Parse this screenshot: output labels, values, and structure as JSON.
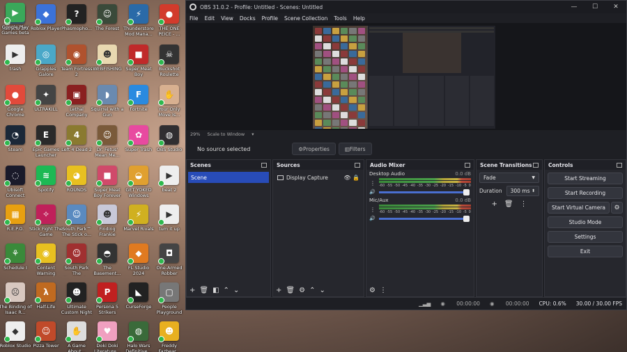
{
  "desktop": {
    "icons": [
      {
        "label": "Recycle Bin",
        "glyph": "🗑",
        "color": "#4a6b8c"
      },
      {
        "label": "Roblox Player",
        "glyph": "◆",
        "color": "#3b72d9"
      },
      {
        "label": "Phasmopho...",
        "glyph": "?",
        "color": "#222222"
      },
      {
        "label": "The Forest",
        "glyph": "☺",
        "color": "#3a4a3a"
      },
      {
        "label": "Thunderstore Mod Mana...",
        "glyph": "⚡",
        "color": "#2a6aa8"
      },
      {
        "label": "THE ONE PEICE - ...",
        "glyph": "●",
        "color": "#d23b2c"
      },
      {
        "label": "trash",
        "glyph": "▶",
        "color": "#eeeeee"
      },
      {
        "label": "Grapples Galore",
        "glyph": "◎",
        "color": "#4aa8c8"
      },
      {
        "label": "Team Fortress 2",
        "glyph": "◉",
        "color": "#b0522e"
      },
      {
        "label": "WEBFISHING",
        "glyph": "☻",
        "color": "#e8d8b0"
      },
      {
        "label": "Super Meat Boy",
        "glyph": "■",
        "color": "#c02a2a"
      },
      {
        "label": "Buckshot Roulette",
        "glyph": "☠",
        "color": "#333333"
      },
      {
        "label": "Google Chrome",
        "glyph": "●",
        "color": "#e24a3b"
      },
      {
        "label": "ULTRAKILL",
        "glyph": "✦",
        "color": "#444444"
      },
      {
        "label": "Lethal Company",
        "glyph": "▣",
        "color": "#8a2020"
      },
      {
        "label": "Squirrel with a Gun",
        "glyph": "◗",
        "color": "#6a8ab0"
      },
      {
        "label": "Fortnite",
        "glyph": "F",
        "color": "#2a8ae0"
      },
      {
        "label": "Your Only Move Is...",
        "glyph": "✋",
        "color": "#d8b090"
      },
      {
        "label": "Steam",
        "glyph": "◔",
        "color": "#1b2838"
      },
      {
        "label": "Epic Games Launcher",
        "glyph": "E",
        "color": "#2a2a2a"
      },
      {
        "label": "Left 4 Dead 2",
        "glyph": "4",
        "color": "#8a7a30"
      },
      {
        "label": "Dr. Fetus' Mean Me...",
        "glyph": "☺",
        "color": "#7a5a3a"
      },
      {
        "label": "Super Trash",
        "glyph": "✿",
        "color": "#e84aa0"
      },
      {
        "label": "OBS Studio",
        "glyph": "◍",
        "color": "#302e31"
      },
      {
        "label": "Ubisoft Connect",
        "glyph": "◌",
        "color": "#1a1a2a"
      },
      {
        "label": "Spotify",
        "glyph": "≋",
        "color": "#1db954"
      },
      {
        "label": "ROUNDS",
        "glyph": "◕",
        "color": "#e8c020"
      },
      {
        "label": "Super Meat Boy Forever",
        "glyph": "■",
        "color": "#d04a6a"
      },
      {
        "label": "GET YOKED Windows",
        "glyph": "◒",
        "color": "#e0a030"
      },
      {
        "label": "beat 2",
        "glyph": "▶",
        "color": "#eeeeee"
      },
      {
        "label": "R.E.P.O.",
        "glyph": "▦",
        "color": "#e8a010"
      },
      {
        "label": "Stick Fight The Game",
        "glyph": "✧",
        "color": "#c0205a"
      },
      {
        "label": "South Park™ The Stick o...",
        "glyph": "☺",
        "color": "#5a8ac0"
      },
      {
        "label": "Finding Frankie",
        "glyph": "☻",
        "color": "#c8c8d8"
      },
      {
        "label": "Marvel Rivals",
        "glyph": "⚡",
        "color": "#d0b020"
      },
      {
        "label": "tum it up",
        "glyph": "▶",
        "color": "#eeeeee"
      },
      {
        "label": "Schedule I",
        "glyph": "⚘",
        "color": "#3a8a3a"
      },
      {
        "label": "Content Warning",
        "glyph": "◉",
        "color": "#e8c020"
      },
      {
        "label": "South Park The Fractured...",
        "glyph": "☺",
        "color": "#a03030"
      },
      {
        "label": "The Basement...",
        "glyph": "◓",
        "color": "#333333"
      },
      {
        "label": "FL Studio 2024",
        "glyph": "◆",
        "color": "#e07a20"
      },
      {
        "label": "One-Armed Robber",
        "glyph": "◘",
        "color": "#444444"
      },
      {
        "label": "The Binding of Isaac R...",
        "glyph": "☹",
        "color": "#d8c8c0"
      },
      {
        "label": "Half-Life",
        "glyph": "λ",
        "color": "#c06a20"
      },
      {
        "label": "Ultimate Custom Night",
        "glyph": "☻",
        "color": "#222222"
      },
      {
        "label": "Persona 5 Strikers",
        "glyph": "P",
        "color": "#c02020"
      },
      {
        "label": "CurseForge",
        "glyph": "◣",
        "color": "#222222"
      },
      {
        "label": "People Playground",
        "glyph": "▢",
        "color": "#777777"
      },
      {
        "label": "Roblox Studio",
        "glyph": "◆",
        "color": "#eeeeee"
      },
      {
        "label": "Pizza Tower",
        "glyph": "☺",
        "color": "#c04a2a"
      },
      {
        "label": "A Game About...",
        "glyph": "✋",
        "color": "#dddddd"
      },
      {
        "label": "Doki Doki Literature...",
        "glyph": "♥",
        "color": "#f0a0c0"
      },
      {
        "label": "Halo Wars Definitive...",
        "glyph": "◍",
        "color": "#3a6a3a"
      },
      {
        "label": "Freddy Fazbear...",
        "glyph": "☻",
        "color": "#e8b020"
      },
      {
        "label": "Google Play Games beta",
        "glyph": "▶",
        "color": "#3aa85a"
      }
    ]
  },
  "obs": {
    "title": "OBS 31.0.2 - Profile: Untitled - Scenes: Untitled",
    "window_controls": {
      "minimize": "—",
      "maximize": "☐",
      "close": "✕"
    },
    "menu": [
      "File",
      "Edit",
      "View",
      "Docks",
      "Profile",
      "Scene Collection",
      "Tools",
      "Help"
    ],
    "zoom": {
      "level": "29%",
      "mode": "Scale to Window"
    },
    "info": {
      "no_source": "No source selected",
      "properties": "Properties",
      "filters": "Filters"
    },
    "scenes": {
      "title": "Scenes",
      "items": [
        "Scene"
      ]
    },
    "sources": {
      "title": "Sources",
      "items": [
        "Display Capture"
      ]
    },
    "mixer": {
      "title": "Audio Mixer",
      "ticks": [
        "-60",
        "-55",
        "-50",
        "-45",
        "-40",
        "-35",
        "-30",
        "-25",
        "-20",
        "-15",
        "-10",
        "-5",
        "0"
      ],
      "channels": [
        {
          "name": "Desktop Audio",
          "db": "0.0 dB",
          "volume": 1.0
        },
        {
          "name": "Mic/Aux",
          "db": "0.0 dB",
          "volume": 1.0
        }
      ]
    },
    "transitions": {
      "title": "Scene Transitions",
      "type": "Fade",
      "duration_label": "Duration",
      "duration": "300 ms"
    },
    "controls": {
      "title": "Controls",
      "start_streaming": "Start Streaming",
      "start_recording": "Start Recording",
      "start_virtual_camera": "Start Virtual Camera",
      "studio_mode": "Studio Mode",
      "settings": "Settings",
      "exit": "Exit"
    },
    "status": {
      "stream_time": "00:00:00",
      "rec_time": "00:00:00",
      "cpu": "CPU: 0.6%",
      "fps": "30.00 / 30.00 FPS"
    }
  }
}
